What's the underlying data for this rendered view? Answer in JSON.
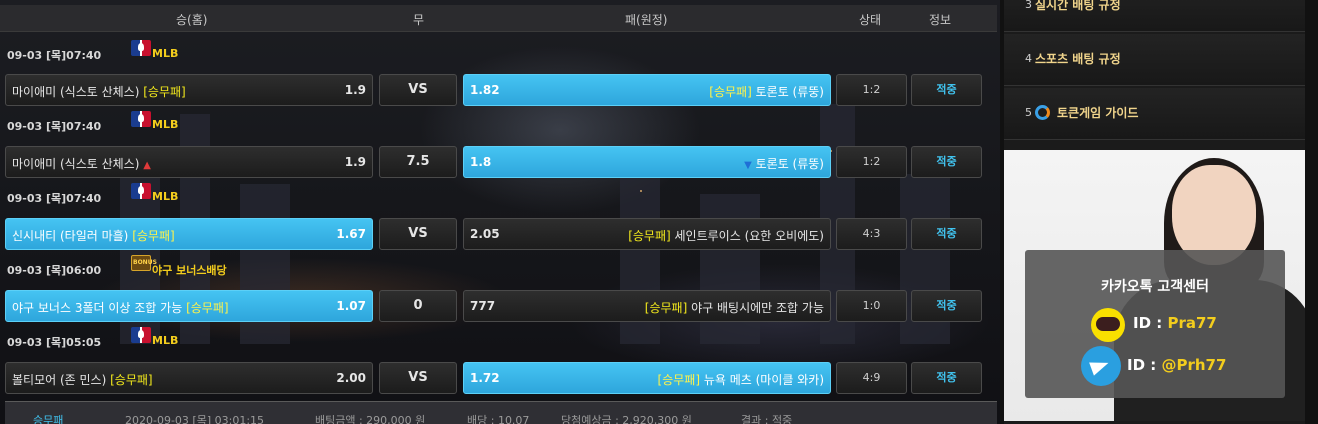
{
  "header": {
    "home": "승(홈)",
    "draw": "무",
    "away": "패(원정)",
    "status": "상태",
    "info": "정보"
  },
  "games": [
    {
      "date": "09-03 [목]07:40",
      "league": "MLB",
      "league_icon": "mlb-logo-icon",
      "home_team": "마이애미 (식스토 산체스)",
      "home_tag": "[승무패]",
      "home_odds": "1.9",
      "draw": "VS",
      "away_odds": "1.82",
      "away_tag": "[승무패]",
      "away_team": "토론토 (류뚱)",
      "selected": "away",
      "status": "1:2",
      "info": "적중"
    },
    {
      "date": "09-03 [목]07:40",
      "league": "MLB",
      "league_icon": "mlb-logo-icon",
      "home_team": "마이애미 (식스토 산체스)",
      "home_tag": "",
      "home_odds": "1.9",
      "draw": "7.5",
      "away_odds": "1.8",
      "away_tag": "",
      "away_team": "토론토 (류뚱)",
      "selected": "away",
      "status": "1:2",
      "info": "적중"
    },
    {
      "date": "09-03 [목]07:40",
      "league": "MLB",
      "league_icon": "mlb-logo-icon",
      "home_team": "신시내티 (타일러 마흘)",
      "home_tag": "[승무패]",
      "home_odds": "1.67",
      "draw": "VS",
      "away_odds": "2.05",
      "away_tag": "[승무패]",
      "away_team": "세인트루이스 (요한 오비에도)",
      "selected": "home",
      "status": "4:3",
      "info": "적중"
    },
    {
      "date": "09-03 [목]06:00",
      "league": "야구 보너스배당",
      "league_icon": "bonus-logo-icon",
      "home_team": "야구 보너스 3폴더 이상 조합 가능",
      "home_tag": "[승무패]",
      "home_odds": "1.07",
      "draw": "0",
      "away_odds": "777",
      "away_tag": "[승무패]",
      "away_team": "야구 배팅시에만 조합 가능",
      "selected": "home",
      "status": "1:0",
      "info": "적중"
    },
    {
      "date": "09-03 [목]05:05",
      "league": "MLB",
      "league_icon": "mlb-logo-icon",
      "home_team": "볼티모어 (존 민스)",
      "home_tag": "[승무패]",
      "home_odds": "2.00",
      "draw": "VS",
      "away_odds": "1.72",
      "away_tag": "[승무패]",
      "away_team": "뉴욕 메츠 (마이클 와카)",
      "selected": "away",
      "status": "4:9",
      "info": "적중"
    }
  ],
  "summary": {
    "type": "승무패",
    "datetime": "2020-09-03 [목] 03:01:15",
    "bet_amount": "배팅금액 : 290,000 원",
    "odds": "배당 : 10.07",
    "expected": "당첨예상금 : 2,920,300 원",
    "result": "결과 : 적중"
  },
  "sidebar": {
    "items": [
      {
        "num": "3",
        "label": "실시간 배팅 규정"
      },
      {
        "num": "4",
        "label": "스포츠 배팅 규정"
      },
      {
        "num": "5",
        "label": "토큰게임 가이드",
        "icon": "token-game-icon"
      }
    ]
  },
  "support": {
    "title": "카카오톡 고객센터",
    "kakao_label": "ID : ",
    "kakao_id": "Pra77",
    "telegram_label": "ID : ",
    "telegram_id": "@Prh77"
  },
  "colors": {
    "accent_blue": "#38b6ea",
    "highlight_yellow": "#f3e91c",
    "league_gold": "#f3cd1d",
    "result_cyan": "#41c3ef"
  }
}
